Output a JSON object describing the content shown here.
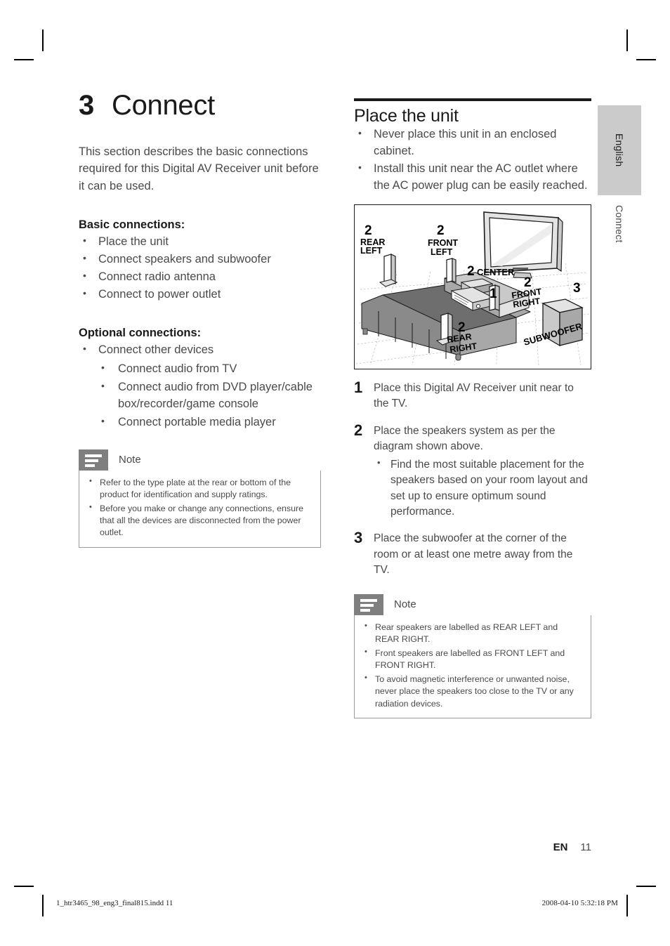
{
  "chapter": {
    "number": "3",
    "title": "Connect"
  },
  "intro": "This section describes the basic connections required for this Digital AV Receiver unit before it can be used.",
  "basic": {
    "heading": "Basic connections:",
    "items": [
      "Place the unit",
      "Connect speakers and subwoofer",
      "Connect radio antenna",
      "Connect to power outlet"
    ]
  },
  "optional": {
    "heading": "Optional connections:",
    "item": "Connect other devices",
    "subitems": [
      "Connect audio from TV",
      "Connect audio from DVD player/cable box/recorder/game console",
      "Connect portable media player"
    ]
  },
  "note_left": {
    "title": "Note",
    "items": [
      "Refer to the type plate at the rear or bottom of the product for identification and supply ratings.",
      "Before you make or change any connections, ensure that all the devices are disconnected from the power outlet."
    ]
  },
  "section": {
    "title": "Place the unit",
    "bullets": [
      "Never place this unit in an enclosed cabinet.",
      "Install this unit near the AC outlet where the AC power plug can be easily reached."
    ]
  },
  "diagram": {
    "labels": {
      "rear_left_num": "2",
      "rear_left": "REAR\nLEFT",
      "front_left_num": "2",
      "front_left": "FRONT\nLEFT",
      "center_num": "2",
      "center": "CENTER",
      "receiver_num": "1",
      "front_right_num": "2",
      "front_right": "FRONT\nRIGHT",
      "rear_right_num": "2",
      "rear_right": "REAR\nRIGHT",
      "subwoofer_num": "3",
      "subwoofer": "SUBWOOFER"
    }
  },
  "steps": [
    {
      "n": "1",
      "text": "Place this Digital AV Receiver unit near to the TV.",
      "sub": []
    },
    {
      "n": "2",
      "text": "Place the speakers system as per the diagram shown above.",
      "sub": [
        "Find the most suitable placement for the speakers based on your room layout and set up to ensure optimum sound performance."
      ]
    },
    {
      "n": "3",
      "text": "Place the subwoofer at the corner of the room or at least one metre away from the TV.",
      "sub": []
    }
  ],
  "note_right": {
    "title": "Note",
    "items": [
      "Rear speakers are labelled as REAR LEFT and REAR RIGHT.",
      "Front speakers are labelled as FRONT LEFT and FRONT RIGHT.",
      "To avoid magnetic interference or unwanted noise, never place the speakers too close to the TV or any radiation devices."
    ]
  },
  "tabs": {
    "language": "English",
    "chapter": "Connect"
  },
  "page": {
    "lang_code": "EN",
    "number": "11"
  },
  "printer_footer": {
    "left": "1_htr3465_98_eng3_final815.indd   11",
    "right": "2008-04-10   5:32:18 PM"
  }
}
